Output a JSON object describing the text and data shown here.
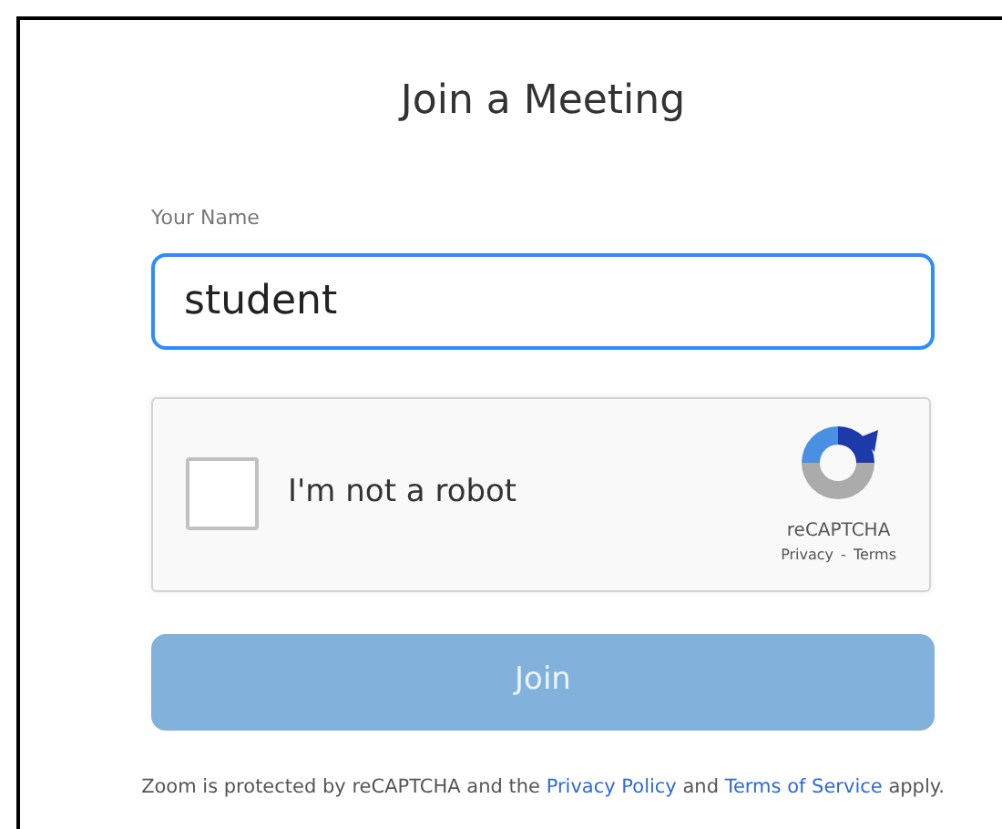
{
  "title": "Join a Meeting",
  "name_field": {
    "label": "Your Name",
    "value": "student",
    "focused": true
  },
  "captcha": {
    "label": "I'm not a robot",
    "checked": false,
    "brand": "reCAPTCHA",
    "privacy_link": "Privacy",
    "separator": "-",
    "terms_link": "Terms"
  },
  "join_button": {
    "label": "Join",
    "disabled": true
  },
  "footer": {
    "text_before": "Zoom is protected by reCAPTCHA and the ",
    "privacy_link": "Privacy Policy",
    "text_middle": " and ",
    "terms_link": "Terms of Service",
    "text_after": " apply."
  }
}
